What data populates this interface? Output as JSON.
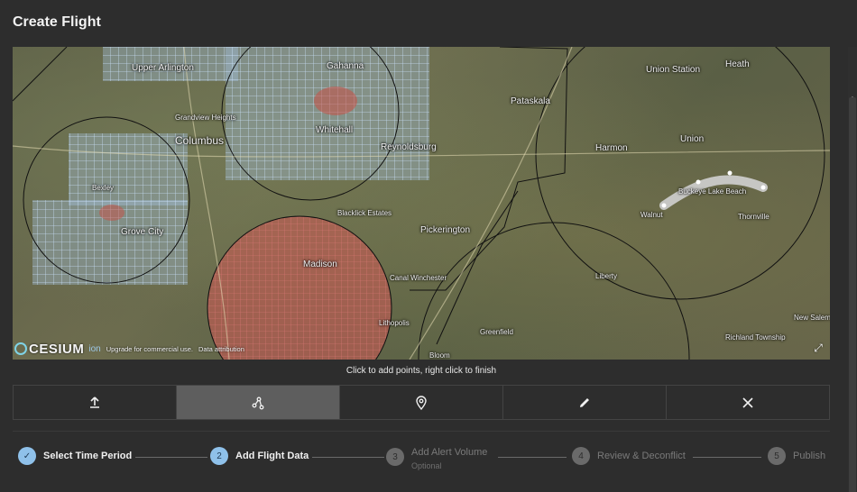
{
  "window": {
    "title": "Create Flight"
  },
  "map": {
    "labels": [
      "Upper Arlington",
      "Gahanna",
      "Union Station",
      "Heath",
      "Grandview Heights",
      "Columbus",
      "Reynoldsburg",
      "Whitehall",
      "Pataskala",
      "Harmon",
      "Union",
      "Bexley",
      "Buckeye Lake Beach",
      "Walnut",
      "Thornville",
      "Grove City",
      "Blacklick Estates",
      "Pickerington",
      "Madison",
      "Canal Winchester",
      "Liberty",
      "Lithopolis",
      "Greenfield",
      "Bloom",
      "Richland Township",
      "New Salem"
    ],
    "attribution": {
      "logo": "CESIUM",
      "ion": "ion",
      "upgrade": "Upgrade for commercial use.",
      "data": "Data attribution"
    },
    "fullscreen_icon": "fullscreen-icon"
  },
  "hint": "Click to add points, right click to finish",
  "toolbar": {
    "tools": [
      {
        "icon": "upload-icon",
        "label": "Upload"
      },
      {
        "icon": "path-icon",
        "label": "Draw Path",
        "active": true
      },
      {
        "icon": "location-pin-icon",
        "label": "Add Point"
      },
      {
        "icon": "pencil-icon",
        "label": "Edit"
      },
      {
        "icon": "close-icon",
        "label": "Clear"
      }
    ]
  },
  "stepper": {
    "steps": [
      {
        "number": "✓",
        "label": "Select Time Period",
        "state": "done"
      },
      {
        "number": "2",
        "label": "Add Flight Data",
        "state": "current"
      },
      {
        "number": "3",
        "label": "Add Alert Volume",
        "sublabel": "Optional",
        "state": "pending"
      },
      {
        "number": "4",
        "label": "Review & Deconflict",
        "state": "pending"
      },
      {
        "number": "5",
        "label": "Publish",
        "state": "pending"
      }
    ]
  },
  "colors": {
    "accent": "#8fc1ea",
    "red_zone": "#d9534f",
    "blue_grid": "#b8d4f0",
    "flight_path": "#cfcfcf"
  }
}
